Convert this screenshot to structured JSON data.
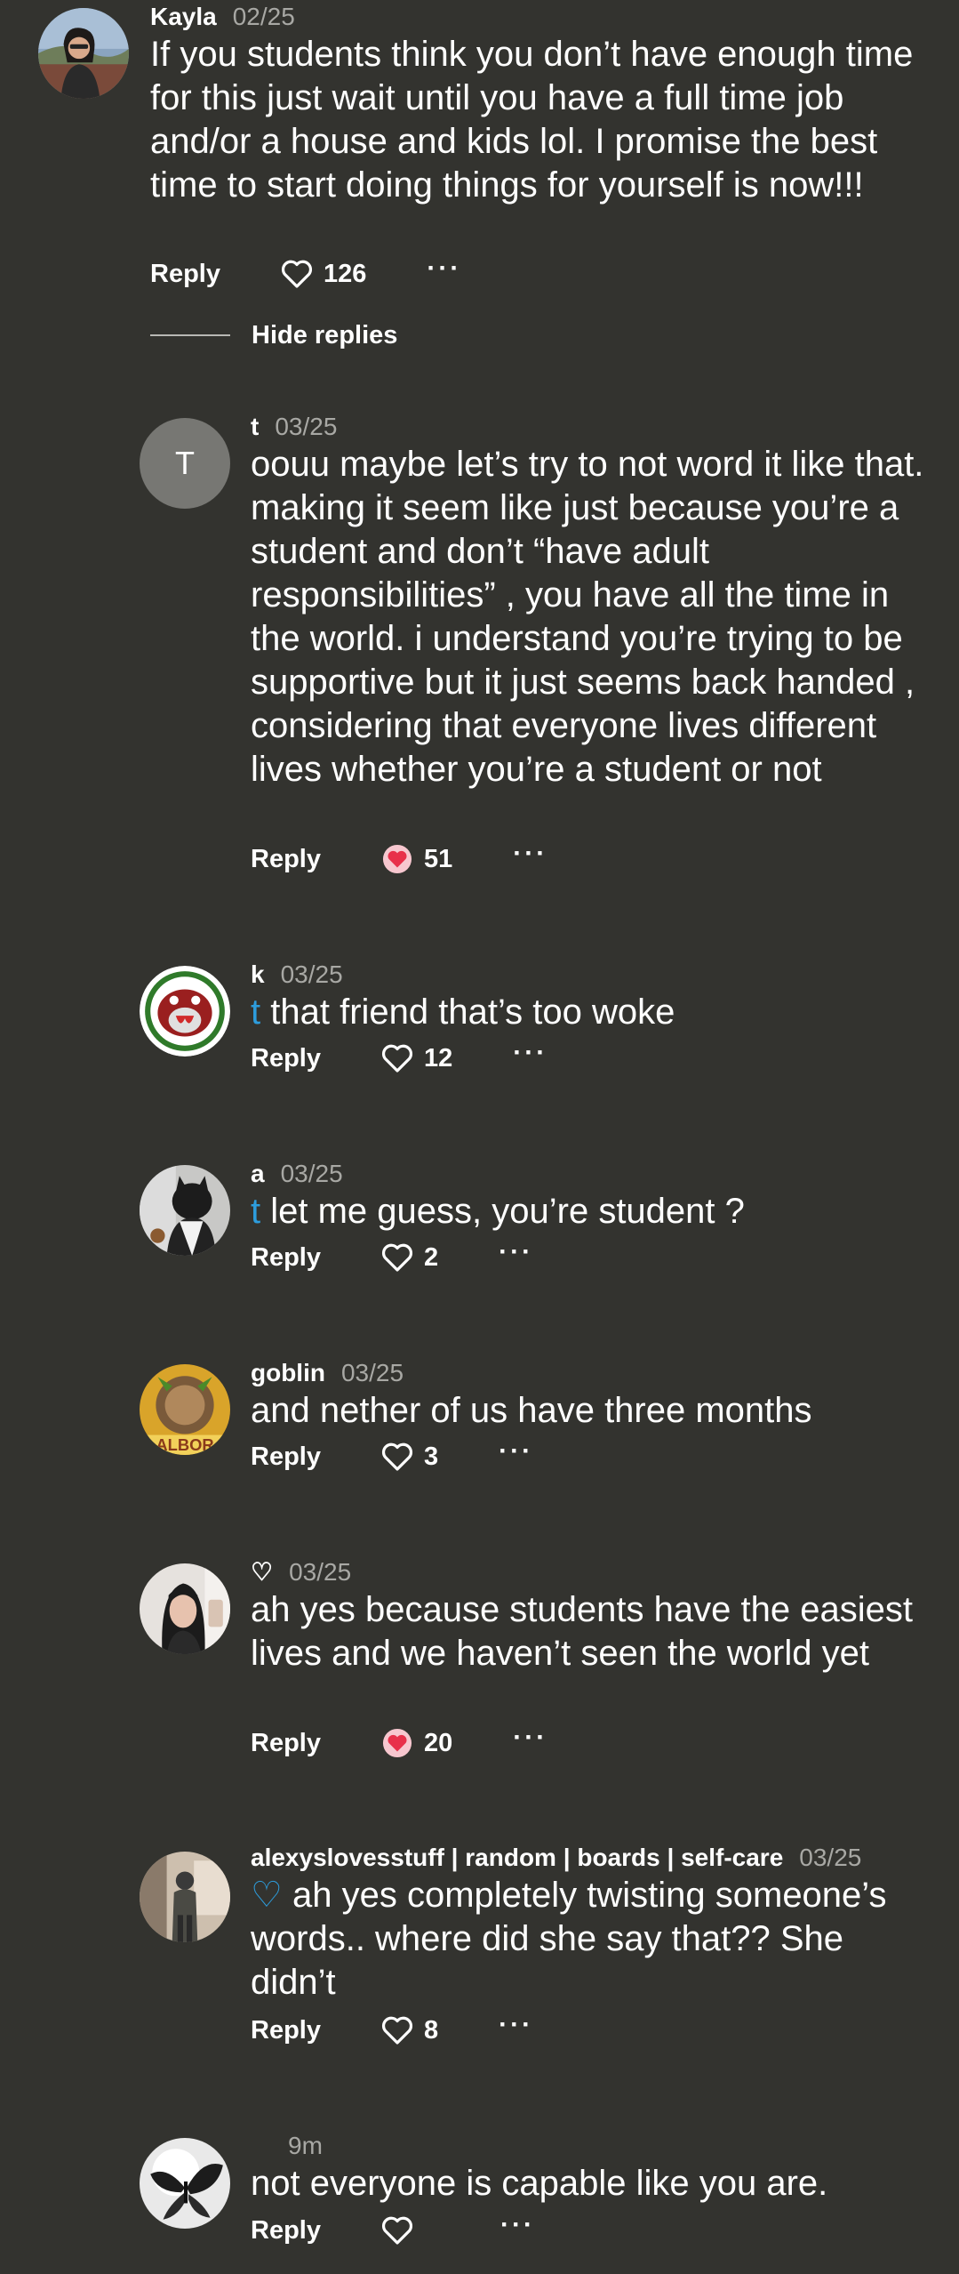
{
  "comments": [
    {
      "username": "Kayla",
      "date": "02/25",
      "mention": "",
      "text": "If you students think you don’t have enough time for this just wait until you have a full time job and/or a house and kids lol. I promise the best time to start doing things for yourself is now!!!",
      "reply_label": "Reply",
      "likes": "126",
      "liked": false,
      "more_label": "···"
    },
    {
      "username": "t",
      "avatar_letter": "T",
      "date": "03/25",
      "mention": "",
      "text": "oouu maybe let’s try to not word it like that. making it seem like just because you’re a student and don’t “have adult responsibilities” , you have all the time in the world. i understand you’re trying to be supportive but it just seems back handed , considering that everyone lives different lives whether you’re a student or not",
      "reply_label": "Reply",
      "likes": "51",
      "liked": true,
      "more_label": "···"
    },
    {
      "username": "k",
      "date": "03/25",
      "mention": "t",
      "text": "that friend that’s too woke",
      "reply_label": "Reply",
      "likes": "12",
      "liked": false,
      "more_label": "···"
    },
    {
      "username": "a",
      "date": "03/25",
      "mention": "t",
      "text": "let me guess, you’re student ?",
      "reply_label": "Reply",
      "likes": "2",
      "liked": false,
      "more_label": "···"
    },
    {
      "username": "goblin",
      "date": "03/25",
      "mention": "",
      "text": "and nether of us have three months",
      "reply_label": "Reply",
      "likes": "3",
      "liked": false,
      "more_label": "···"
    },
    {
      "username": "♡",
      "date": "03/25",
      "mention": "",
      "text": "ah yes because students have the easiest lives and we haven’t seen the world yet",
      "reply_label": "Reply",
      "likes": "20",
      "liked": true,
      "more_label": "···"
    },
    {
      "username": "alexyslovesstuff | random | boards | self-care",
      "date": "03/25",
      "mention": "♡",
      "text": "ah yes completely twisting someone’s words.. where did she say that?? She didn’t",
      "reply_label": "Reply",
      "likes": "8",
      "liked": false,
      "more_label": "···"
    },
    {
      "username": "",
      "date": "9m",
      "mention": "",
      "text": "not everyone is capable like you are.",
      "reply_label": "Reply",
      "likes": "",
      "liked": false,
      "more_label": "···"
    }
  ],
  "thread": {
    "hide_replies_label": "Hide replies"
  },
  "colors": {
    "background": "#33332f",
    "mention": "#2d9ddd",
    "liked_heart": "#e8304a",
    "liked_circle": "#f7c7cf",
    "secondary_text": "#a8a8a4"
  },
  "icons": {
    "like": "heart-icon",
    "more": "more-icon"
  }
}
